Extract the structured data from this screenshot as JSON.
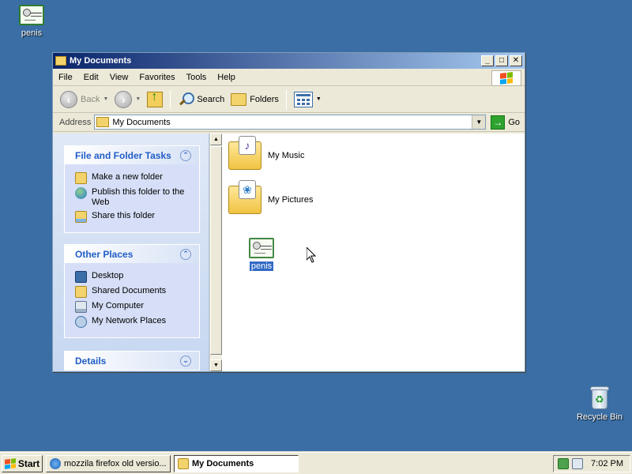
{
  "desktop": {
    "icons": [
      {
        "label": "penis"
      },
      {
        "label": "Recycle Bin"
      }
    ]
  },
  "window": {
    "title": "My Documents",
    "controls": {
      "minimize": "_",
      "maximize": "□",
      "close": "✕"
    },
    "menu": [
      "File",
      "Edit",
      "View",
      "Favorites",
      "Tools",
      "Help"
    ],
    "toolbar": {
      "back": "Back",
      "search": "Search",
      "folders": "Folders"
    },
    "address": {
      "label": "Address",
      "value": "My Documents",
      "go": "Go"
    },
    "tasks": {
      "file_folder": {
        "title": "File and Folder Tasks",
        "items": [
          "Make a new folder",
          "Publish this folder to the Web",
          "Share this folder"
        ]
      },
      "other_places": {
        "title": "Other Places",
        "items": [
          "Desktop",
          "Shared Documents",
          "My Computer",
          "My Network Places"
        ]
      },
      "details": {
        "title": "Details"
      }
    },
    "files": [
      {
        "name": "My Music",
        "emblem": "♪"
      },
      {
        "name": "My Pictures",
        "emblem": "❀"
      }
    ],
    "dragging": {
      "label": "penis"
    }
  },
  "taskbar": {
    "start": "Start",
    "tasks": [
      {
        "label": "mozzila firefox old versio..."
      },
      {
        "label": "My Documents"
      }
    ],
    "clock": "7:02 PM"
  }
}
